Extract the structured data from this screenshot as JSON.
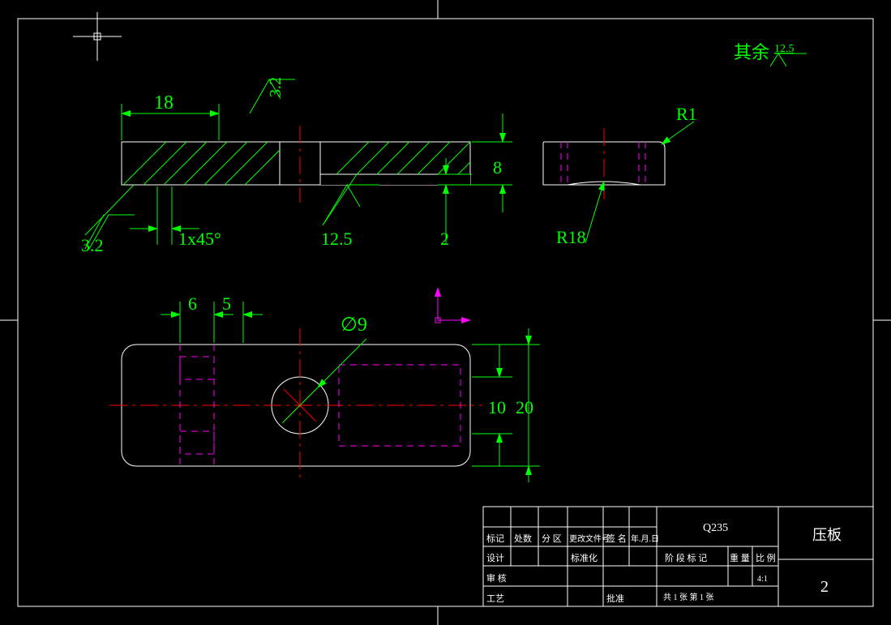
{
  "surface_note": {
    "text": "其余",
    "value": "12.5"
  },
  "dims": {
    "d18": "18",
    "sf3_2_top": "3.2",
    "sf3_2_left": "3.2",
    "chamfer": "1x45°",
    "sf12_5": "12.5",
    "d2": "2",
    "d8": "8",
    "R1": "R1",
    "R18": "R18",
    "d6": "6",
    "d5": "5",
    "dia9": "∅9",
    "d10": "10",
    "d20": "20"
  },
  "titleblock": {
    "material": "Q235",
    "part_name": "压板",
    "part_no": "2",
    "scale": "4:1",
    "headers": {
      "mark": "标记",
      "count": "处数",
      "zone": "分 区",
      "change": "更改文件号",
      "sign": "签 名",
      "date": "年.月.日",
      "design": "设计",
      "std": "标准化",
      "audit": "审 核",
      "craft": "工艺",
      "approve": "批准",
      "stage": "阶 段 标 记",
      "mass": "重 量",
      "ratio": "比 例",
      "sheets": "共  1  张    第  1  张"
    }
  }
}
